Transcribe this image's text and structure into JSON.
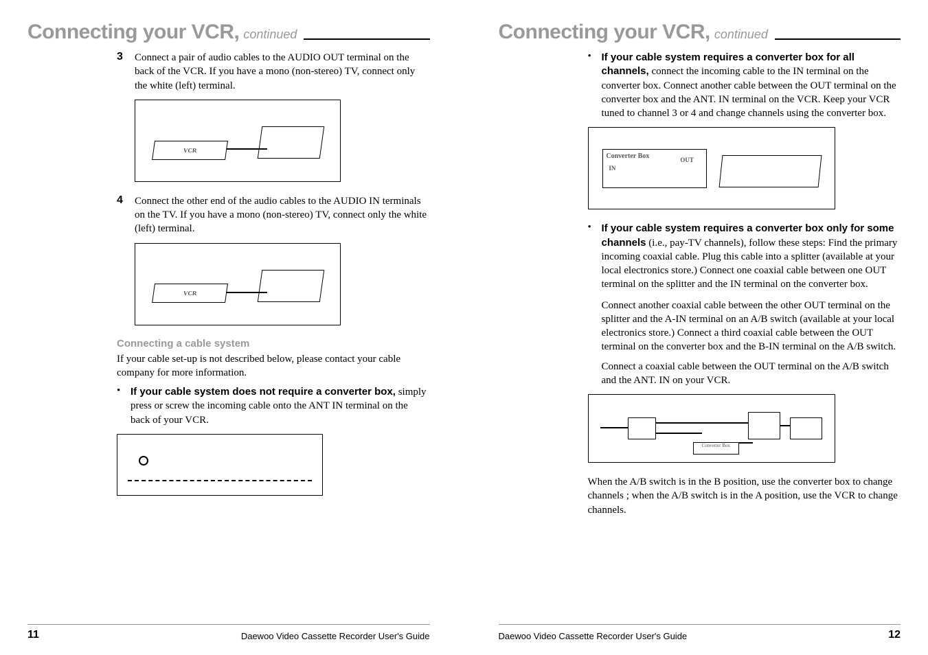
{
  "left": {
    "title": "Connecting your VCR,",
    "cont": "continued",
    "step3_num": "3",
    "step3_text": "Connect a pair of audio cables to the AUDIO OUT terminal on the back of the VCR. If you have a mono (non-stereo) TV, connect only the white (left) terminal.",
    "step4_num": "4",
    "step4_text": "Connect the other end of the audio cables to the AUDIO IN terminals on the TV. If you have a mono (non-stereo) TV, connect only the white (left) terminal.",
    "subhead": "Connecting a cable system",
    "sub_para": "If your cable set-up is not described below, please contact your cable company for more information.",
    "bullet1_lead": "If your cable system does not require a converter box,",
    "bullet1_rest": " simply press or screw the incoming cable onto the ANT IN terminal on the back of your VCR.",
    "vcr_label": "VCR",
    "footer_page": "11",
    "footer_text": "Daewoo Video Cassette Recorder User's Guide"
  },
  "right": {
    "title": "Connecting your VCR,",
    "cont": "continued",
    "bullet2_lead": "If your cable system requires a converter box for all channels,",
    "bullet2_rest": " connect the incoming cable to the IN terminal on the converter box. Connect another cable between the OUT terminal on the converter box and the ANT. IN terminal on the VCR. Keep your VCR tuned to channel 3 or 4 and change channels using the converter box.",
    "conv_label": "Converter Box",
    "conv_in": "IN",
    "conv_out": "OUT",
    "bullet3_lead": "If your cable system requires a converter box only for some channels",
    "bullet3_rest": " (i.e., pay-TV channels), follow these steps: Find the primary incoming coaxial cable. Plug this cable into a splitter (available at your local electronics store.) Connect one coaxial cable between one OUT terminal on the splitter and the IN terminal on the converter box.",
    "para2": "Connect another coaxial cable between the other OUT terminal on the splitter and the A-IN terminal on an A/B switch (available at your local electronics store.) Connect a third coaxial cable between the OUT terminal on the converter box and the B-IN terminal on the A/B switch.",
    "para3": "Connect a coaxial cable between the OUT terminal on the A/B switch and the ANT. IN on your VCR.",
    "ab_conv_label": "Converter Box",
    "closing": "When the A/B switch is in the B position, use the converter box to change channels ; when the A/B switch is in the A position, use the VCR to change channels.",
    "footer_page": "12",
    "footer_text": "Daewoo Video Cassette Recorder User's Guide"
  }
}
